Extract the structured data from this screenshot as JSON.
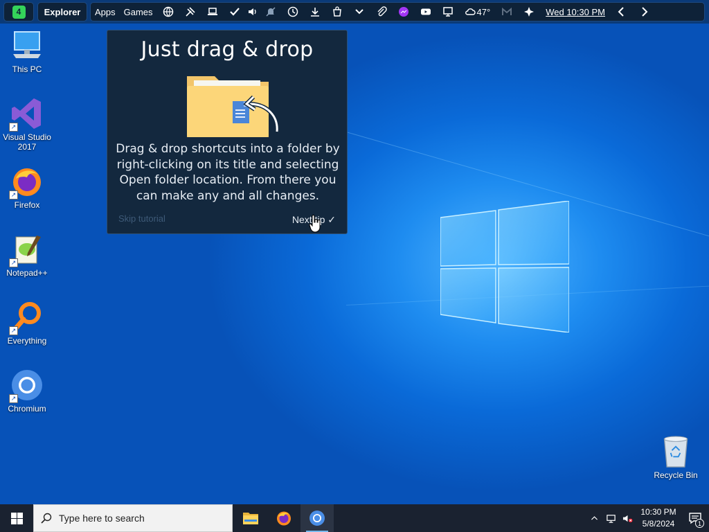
{
  "topbar": {
    "launcher_badge": "4",
    "explorer_label": "Explorer",
    "apps_label": "Apps",
    "games_label": "Games",
    "weather_temp": "47°",
    "datetime": "Wed 10:30 PM",
    "icons": [
      "globe-icon",
      "tools-icon",
      "laptop-icon",
      "check-icon",
      "volume-icon",
      "notifications-muted-icon",
      "clock-icon",
      "download-icon",
      "shopping-bag-icon",
      "chevron-down-icon",
      "paperclip-icon",
      "messenger-icon",
      "youtube-icon",
      "monitor-icon",
      "cloud-icon",
      "gmail-icon",
      "gem-icon",
      "back-arrow-icon",
      "forward-arrow-icon"
    ]
  },
  "desktop_icons": [
    {
      "label": "This PC",
      "icon": "computer-icon"
    },
    {
      "label": "Visual Studio 2017",
      "icon": "visual-studio-icon"
    },
    {
      "label": "Firefox",
      "icon": "firefox-icon"
    },
    {
      "label": "Notepad++",
      "icon": "notepadpp-icon"
    },
    {
      "label": "Everything",
      "icon": "everything-search-icon"
    },
    {
      "label": "Chromium",
      "icon": "chromium-icon"
    }
  ],
  "recycle_bin": {
    "label": "Recycle Bin"
  },
  "tip": {
    "title": "Just drag & drop",
    "body": "Drag & drop shortcuts into a folder by right-clicking on its title and selecting Open folder location. From there you can make any and all changes.",
    "skip_label": "Skip tutorial",
    "next_label": "Next tip ✓"
  },
  "taskbar": {
    "search_placeholder": "Type here to search",
    "apps": [
      "file-explorer-icon",
      "firefox-icon",
      "chromium-icon"
    ],
    "clock_time": "10:30 PM",
    "clock_date": "5/8/2024",
    "notification_count": "1"
  },
  "colors": {
    "desktop_blue": "#0a63cf",
    "tip_background": "#13283e",
    "taskbar": "#1a2230",
    "launcher_green": "#34d35a"
  }
}
